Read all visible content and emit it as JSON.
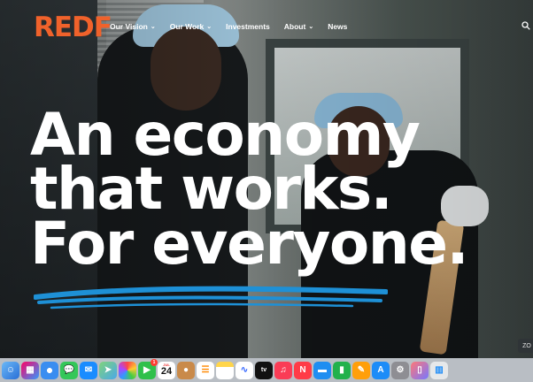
{
  "brand": {
    "logo_text": "REDF",
    "accent": "#f0622b"
  },
  "nav": {
    "items": [
      {
        "label": "Our Vision",
        "has_dropdown": true
      },
      {
        "label": "Our Work",
        "has_dropdown": true
      },
      {
        "label": "Investments",
        "has_dropdown": false
      },
      {
        "label": "About",
        "has_dropdown": true
      },
      {
        "label": "News",
        "has_dropdown": false
      }
    ],
    "dropdown_glyph": "⌄",
    "search_icon": "search-icon"
  },
  "hero": {
    "line1": "An economy",
    "line2": "that works.",
    "line3": "For everyone.",
    "underline_color": "#1e90d6"
  },
  "zoom_label": "ZO",
  "dock": {
    "background": "#b9bec4",
    "calendar": {
      "month": "JUL",
      "day": "24"
    },
    "facetime_badge": "1",
    "icons": [
      "finder-icon",
      "launchpad-icon",
      "safari-icon",
      "messages-icon",
      "mail-icon",
      "maps-icon",
      "photos-icon",
      "facetime-icon",
      "calendar-icon",
      "contacts-icon",
      "reminders-icon",
      "notes-icon",
      "freeform-icon",
      "tv-icon",
      "music-icon",
      "news-icon",
      "keynote-icon",
      "numbers-icon",
      "pages-icon",
      "app-store-icon",
      "system-settings-icon",
      "iphone-mirroring-icon",
      "trash-icon"
    ]
  }
}
